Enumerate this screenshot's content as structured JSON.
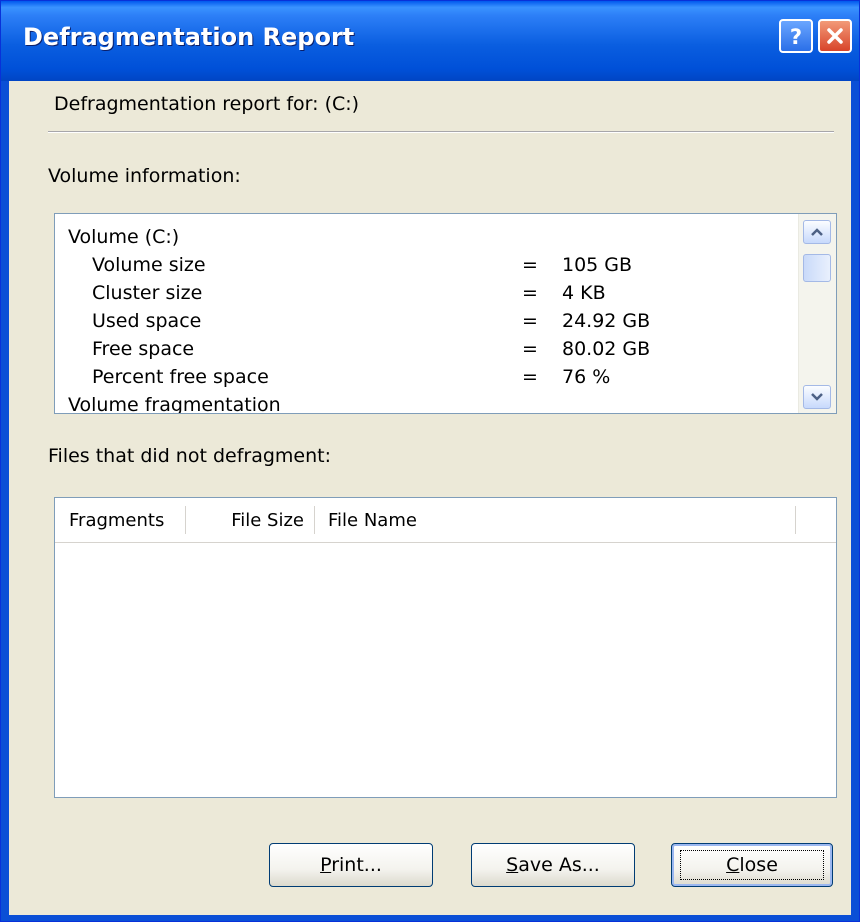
{
  "window": {
    "title": "Defragmentation Report",
    "help_glyph": "?",
    "close_glyph": "✕"
  },
  "report": {
    "heading": "Defragmentation report for:  (C:)",
    "volume_info_label": "Volume information:",
    "volume_info": {
      "volume_name": "Volume  (C:)",
      "rows": [
        {
          "label": "Volume size",
          "eq": "=",
          "value": "105 GB"
        },
        {
          "label": "Cluster size",
          "eq": "=",
          "value": "4 KB"
        },
        {
          "label": "Used space",
          "eq": "=",
          "value": "24.92 GB"
        },
        {
          "label": "Free space",
          "eq": "=",
          "value": "80.02 GB"
        },
        {
          "label": "Percent free space",
          "eq": "=",
          "value": "76 %"
        }
      ],
      "next_section": "Volume fragmentation"
    },
    "files_label": "Files that did not defragment:",
    "files_columns": [
      "Fragments",
      "File Size",
      "File Name"
    ]
  },
  "buttons": {
    "print_mnemonic": "P",
    "print_rest": "rint...",
    "save_mnemonic": "S",
    "save_rest": "ave As...",
    "close_mnemonic": "C",
    "close_rest": "lose"
  },
  "colors": {
    "title_bar": "#0a5ee0",
    "dialog_face": "#ece9d8",
    "field_border": "#7f9db9"
  },
  "icons": {
    "help": "question-mark-icon",
    "close": "close-x-icon",
    "scroll_up": "chevron-up-icon",
    "scroll_down": "chevron-down-icon"
  }
}
